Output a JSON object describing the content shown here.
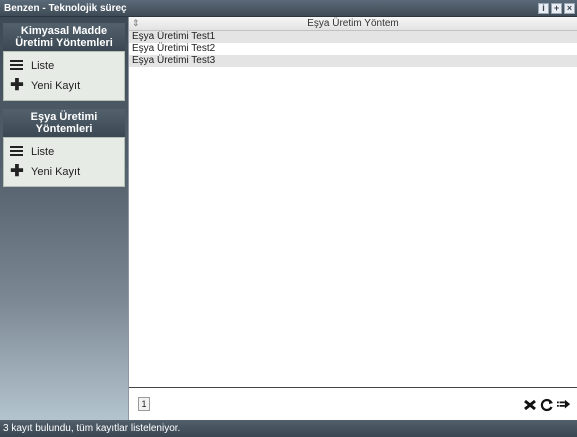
{
  "window": {
    "title": "Benzen - Teknolojik süreç",
    "btn_info": "i",
    "btn_plus": "+",
    "btn_close": "×"
  },
  "sidebar": {
    "panels": [
      {
        "title": "Kimyasal Madde Üretimi Yöntemleri",
        "items": [
          {
            "label": "Liste",
            "icon": "list-icon"
          },
          {
            "label": "Yeni Kayıt",
            "icon": "plus-icon"
          }
        ]
      },
      {
        "title": "Eşya Üretimi Yöntemleri",
        "items": [
          {
            "label": "Liste",
            "icon": "list-icon"
          },
          {
            "label": "Yeni Kayıt",
            "icon": "plus-icon"
          }
        ]
      }
    ]
  },
  "grid": {
    "column_header": "Eşya Üretim Yöntem",
    "sort_icon": "⇕",
    "rows": [
      "Eşya Üretimi Test1",
      "Eşya Üretimi Test2",
      "Eşya Üretimi Test3"
    ]
  },
  "pager": {
    "page": "1",
    "tools": [
      "clear-icon",
      "refresh-icon",
      "export-icon"
    ]
  },
  "status": {
    "text": "3 kayıt bulundu, tüm kayıtlar listeleniyor."
  },
  "colors": {
    "accent": "#3e4b57",
    "alt_row": "#e4e4e4"
  }
}
